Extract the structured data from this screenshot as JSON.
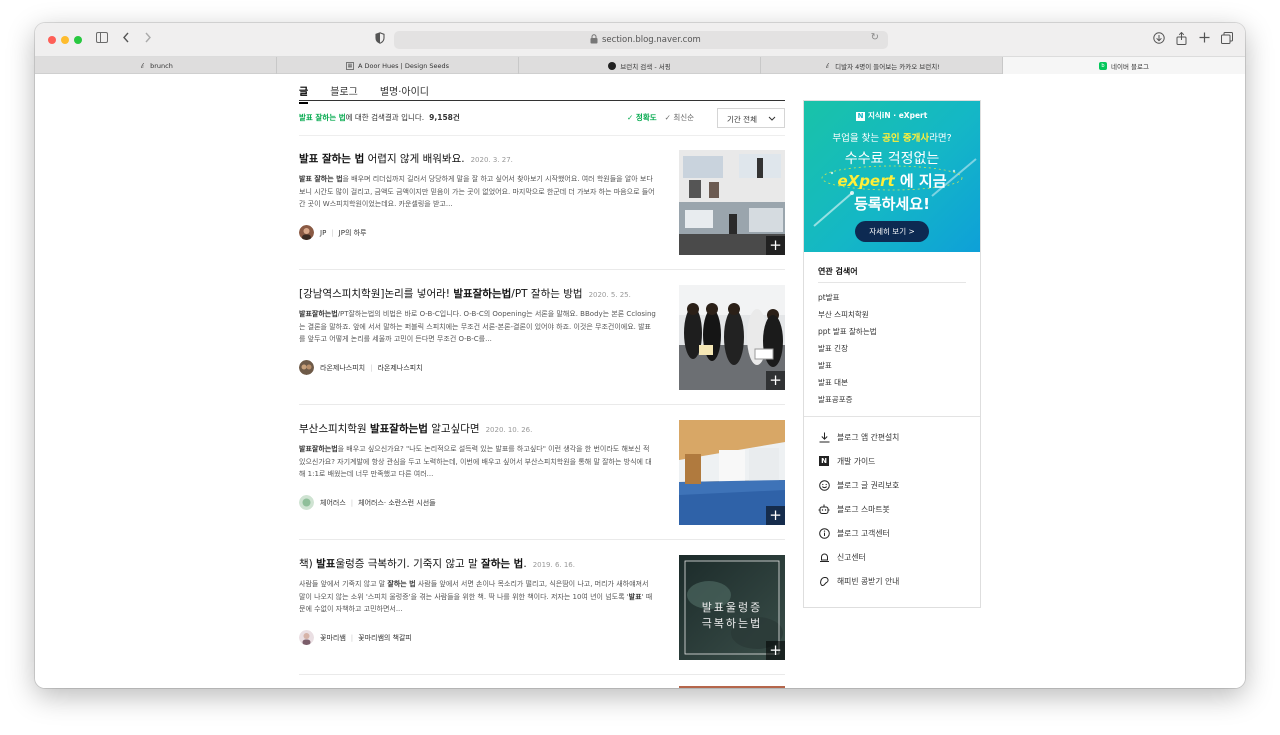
{
  "browser": {
    "url": "section.blog.naver.com",
    "tabs": [
      {
        "label": "brunch",
        "icon": "brunch-b-icon",
        "active": false
      },
      {
        "label": "A Door Hues | Design Seeds",
        "icon": "design-seeds-icon",
        "active": false
      },
      {
        "label": "브런치 검색 - 서핑",
        "icon": "dark-circle-icon",
        "active": false
      },
      {
        "label": "디발자 4명이 들어보는 카카오 브런치!",
        "icon": "brunch-b-icon",
        "active": false
      },
      {
        "label": "네이버 블로그",
        "icon": "naver-blog-icon",
        "active": true
      }
    ]
  },
  "search": {
    "scope_tabs": [
      "글",
      "블로그",
      "별명·아이디"
    ],
    "summary_keyword": "발표 잘하는 법",
    "summary_text": "에 대한 검색결과 입니다.",
    "count": "9,158건",
    "sort_options": [
      "정확도",
      "최신순"
    ],
    "period_label": "기간 전체"
  },
  "results": [
    {
      "title_parts": [
        {
          "t": "발표 잘하는 법",
          "b": true
        },
        {
          "t": " 어렵지 않게 배워봐요.",
          "b": false
        }
      ],
      "date": "2020. 3. 27.",
      "snippet_parts": [
        {
          "t": "발표 잘하는 법",
          "b": true
        },
        {
          "t": "을 배우며 리더십까지 길러서 당당하게 말을 잘 하고 싶어서 찾아보기 시작했어요. 여러 학원들을 알아 보다 보니 시간도 많이 걸리고, 금액도 금액이지만 믿음이 가는 곳이 없었어요. 마지막으로 한군데 더 가보자 하는 마음으로 들어간 곳이 W스피치학원이었는데요. 카운셀링을 받고...",
          "b": false
        }
      ],
      "author": "JP",
      "blog": "JP의 하루"
    },
    {
      "title_parts": [
        {
          "t": "[강남역스피치학원]논리를 넣어라! ",
          "b": false
        },
        {
          "t": "발표잘하는법",
          "b": true
        },
        {
          "t": "/PT 잘하는 방법",
          "b": false
        }
      ],
      "date": "2020. 5. 25.",
      "snippet_parts": [
        {
          "t": "발표잘하는법",
          "b": true
        },
        {
          "t": "/PT잘하는법의 비법은 바로 O-B-C입니다. O-B-C의 Oopening는 서론을 말해요. BBody는 본론 Cclosing는 결론을 말하죠. 앞에 서서 말하는 퍼블릭 스피치에는 무조건 서론-본론-결론이 있어야 하죠. 이것은 무조건이에요. 발표를 앞두고 어떻게 논리를 세울까 고민이 든다면 무조건 O-B-C를...",
          "b": false
        }
      ],
      "author": "라온제나스피치",
      "blog": "라온제나스피치"
    },
    {
      "title_parts": [
        {
          "t": "부산스피치학원 ",
          "b": false
        },
        {
          "t": "발표잘하는법",
          "b": true
        },
        {
          "t": " 알고싶다면",
          "b": false
        }
      ],
      "date": "2020. 10. 26.",
      "snippet_parts": [
        {
          "t": "발표잘하는법",
          "b": true
        },
        {
          "t": "을 배우고 싶으신가요? \"나도 논리적으로 설득력 있는 발표를 하고싶다\" 이런 생각을 한 번이라도 해보신 적 있으신가요? 자기계발에 항상 관심을 두고 노력하는데, 이번에 배우고 싶어서 부산스피치학원을 통해 말 잘하는 방식에 대해 1:1로 배웠는데 너무 만족했고 다른 여러...",
          "b": false
        }
      ],
      "author": "체어러스",
      "blog": "체어러스· 소란스런 시선들"
    },
    {
      "title_parts": [
        {
          "t": "책) ",
          "b": false
        },
        {
          "t": "발표",
          "b": true
        },
        {
          "t": "울렁증 극복하기. 기죽지 않고 말 ",
          "b": false
        },
        {
          "t": "잘하는 법",
          "b": true
        },
        {
          "t": ".",
          "b": false
        }
      ],
      "date": "2019. 6. 16.",
      "snippet_parts": [
        {
          "t": "사람들 앞에서 기죽지 않고 말 ",
          "b": false
        },
        {
          "t": "잘하는 법",
          "b": true
        },
        {
          "t": " 사람들 앞에서 서면 손이나 목소리가 떨리고, 식은땀이 나고, 머리가 새하얘져서 말이 나오지 않는 소위 '스피치 울렁증'을 겪는 사람들을 위한 책. 딱 나를 위한 책이다. 저자는 10여 년이 넘도록 '",
          "b": false
        },
        {
          "t": "발표",
          "b": true
        },
        {
          "t": "' 때문에 수없이 자책하고 고민하면서...",
          "b": false
        }
      ],
      "author": "꽃마리쌤",
      "blog": "꽃마리쌤의 책갈피",
      "thumb_text": [
        "발표울렁증",
        "극복하는법"
      ]
    }
  ],
  "sidebar": {
    "ad": {
      "brand": "지식iN · eXpert",
      "line1_pre": "부업을 찾는 ",
      "line1_hl": "공인 중개사",
      "line1_post": "라면?",
      "line2": "수수료 걱정없는",
      "line3_ex": "eXpert",
      "line3_rest": " 에 지금",
      "line4": "등록하세요!",
      "button": "자세히 보기 >"
    },
    "related_title": "연관 검색어",
    "related": [
      "pt발표",
      "부산 스피치학원",
      "ppt 발표 잘하는법",
      "발표 긴장",
      "발표",
      "발표 대본",
      "발표공포증"
    ],
    "links": [
      {
        "label": "블로그 앱 간편설치",
        "icon": "download-icon"
      },
      {
        "label": "개발 가이드",
        "icon": "naver-n-icon"
      },
      {
        "label": "블로그 글 권리보호",
        "icon": "smile-icon"
      },
      {
        "label": "블로그 스마트봇",
        "icon": "robot-icon"
      },
      {
        "label": "블로그 고객센터",
        "icon": "info-icon"
      },
      {
        "label": "신고센터",
        "icon": "bell-icon"
      },
      {
        "label": "해피빈 콩받기 안내",
        "icon": "bean-icon"
      }
    ]
  },
  "colors": {
    "naver_green": "#03a94d",
    "ad_gradient_start": "#19c3a8",
    "ad_gradient_end": "#0ea0d8",
    "ad_button": "#0d2a52"
  }
}
